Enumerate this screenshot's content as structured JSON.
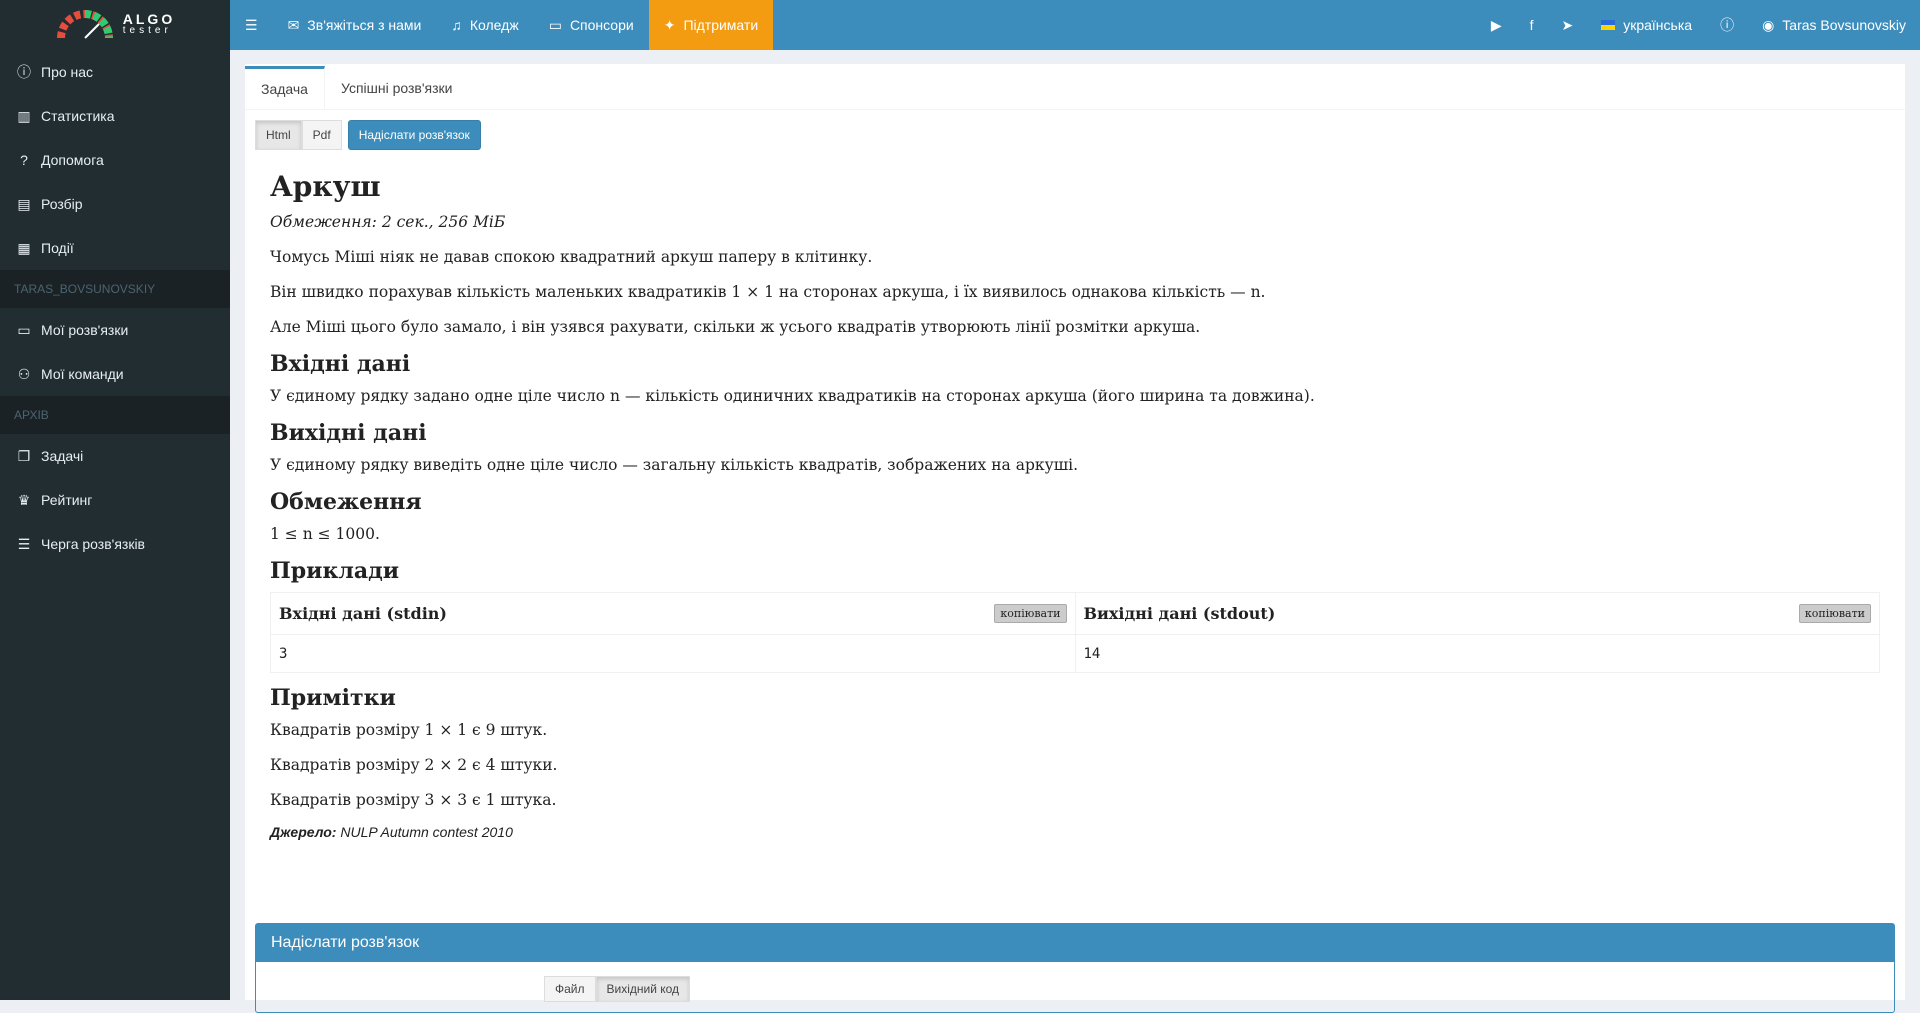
{
  "logo": {
    "line1": "ALGO",
    "line2": "tester"
  },
  "sidebar": {
    "items_top": [
      {
        "label": "Про нас",
        "icon": "info-icon"
      },
      {
        "label": "Статистика",
        "icon": "bar-chart-icon"
      },
      {
        "label": "Допомога",
        "icon": "question-icon"
      },
      {
        "label": "Розбір",
        "icon": "book-icon"
      },
      {
        "label": "Події",
        "icon": "calendar-icon"
      }
    ],
    "user_header": "TARAS_BOVSUNOVSKIY",
    "items_user": [
      {
        "label": "Мої розв'язки",
        "icon": "document-icon"
      },
      {
        "label": "Мої команди",
        "icon": "users-icon"
      }
    ],
    "archive_header": "АРХІВ",
    "items_archive": [
      {
        "label": "Задачі",
        "icon": "copy-icon"
      },
      {
        "label": "Рейтинг",
        "icon": "trophy-icon"
      },
      {
        "label": "Черга розв'язків",
        "icon": "list-icon"
      }
    ]
  },
  "topbar": {
    "contact": "Зв'яжіться з нами",
    "college": "Коледж",
    "sponsors": "Спонсори",
    "support": "Підтримати",
    "language": "українська",
    "user": "Taras Bovsunovskiy"
  },
  "tabs": {
    "problem": "Задача",
    "solutions": "Успішні розв'язки"
  },
  "buttons": {
    "html": "Html",
    "pdf": "Pdf",
    "submit": "Надіслати розв'язок"
  },
  "problem": {
    "title": "Аркуш",
    "limits": "Обмеження: 2 сек., 256 МіБ",
    "statement": [
      "Чомусь Міші ніяк не давав спокою квадратний аркуш паперу в клітинку.",
      "Він швидко порахував кількість маленьких квадратиків 1 × 1 на сторонах аркуша, і їх виявилось однакова кількість — n.",
      "Але Міші цього було замало, і він узявся рахувати, скільки ж усього квадратів утворюють лінії розмітки аркуша."
    ],
    "input_title": "Вхідні дані",
    "input_text": "У єдиному рядку задано одне ціле число n — кількість одиничних квадратиків на сторонах аркуша (його ширина та довжина).",
    "output_title": "Вихідні дані",
    "output_text": "У єдиному рядку виведіть одне ціле число — загальну кількість квадратів, зображених на аркуші.",
    "constraints_title": "Обмеження",
    "constraints_text": "1 ≤ n ≤ 1000.",
    "examples_title": "Приклади",
    "examples": {
      "stdin_header": "Вхідні дані (stdin)",
      "stdout_header": "Вихідні дані (stdout)",
      "copy_label": "копіювати",
      "stdin": "3",
      "stdout": "14"
    },
    "notes_title": "Примітки",
    "notes": [
      "Квадратів розміру 1 × 1 є 9 штук.",
      "Квадратів розміру 2 × 2 є 4 штуки.",
      "Квадратів розміру 3 × 3 є 1 штука."
    ],
    "source_label": "Джерело:",
    "source_value": "NULP Autumn contest 2010"
  },
  "submit_box": {
    "title": "Надіслати розв'язок",
    "file": "Файл",
    "source": "Вихідний код"
  }
}
